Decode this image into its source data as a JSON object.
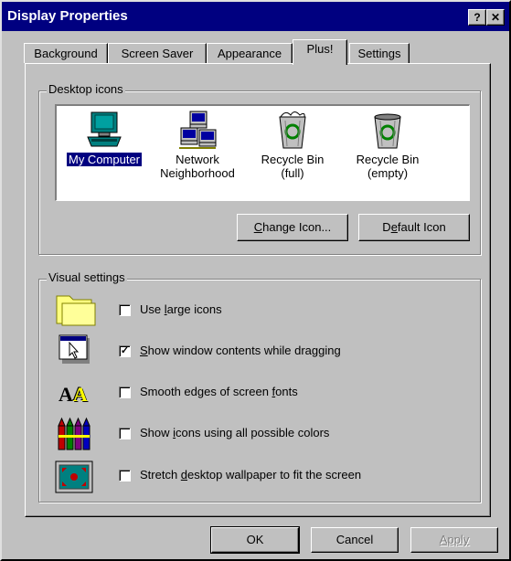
{
  "window": {
    "title": "Display Properties",
    "help_label": "?",
    "close_label": "✕"
  },
  "tabs": [
    {
      "label": "Background"
    },
    {
      "label": "Screen Saver"
    },
    {
      "label": "Appearance"
    },
    {
      "label": "Plus!",
      "active": true
    },
    {
      "label": "Settings"
    }
  ],
  "desktop_icons": {
    "legend": "Desktop icons",
    "items": [
      {
        "line1": "My Computer",
        "line2": "",
        "icon": "my-computer-icon",
        "selected": true
      },
      {
        "line1": "Network",
        "line2": "Neighborhood",
        "icon": "network-neighborhood-icon"
      },
      {
        "line1": "Recycle Bin",
        "line2": "(full)",
        "icon": "recycle-bin-full-icon"
      },
      {
        "line1": "Recycle Bin",
        "line2": "(empty)",
        "icon": "recycle-bin-empty-icon"
      }
    ],
    "change_icon": {
      "pre": "",
      "hot": "C",
      "post": "hange Icon..."
    },
    "default_icon": {
      "pre": "D",
      "hot": "e",
      "post": "fault Icon"
    }
  },
  "visual_settings": {
    "legend": "Visual settings",
    "options": [
      {
        "pre": "Use ",
        "hot": "l",
        "post": "arge icons",
        "checked": false,
        "icon": "folder-icon"
      },
      {
        "pre": "",
        "hot": "S",
        "post": "how window contents while dragging",
        "checked": true,
        "icon": "window-drag-icon"
      },
      {
        "pre": "Smooth edges of screen ",
        "hot": "f",
        "post": "onts",
        "checked": false,
        "icon": "fonts-icon"
      },
      {
        "pre": "Show ",
        "hot": "i",
        "post": "cons using all possible colors",
        "checked": false,
        "icon": "crayons-icon"
      },
      {
        "pre": "Stretch ",
        "hot": "d",
        "post": "esktop wallpaper to fit the screen",
        "checked": false,
        "icon": "monitor-wallpaper-icon"
      }
    ]
  },
  "buttons": {
    "ok": "OK",
    "cancel": "Cancel",
    "apply": "Apply"
  },
  "colors": {
    "titlebar": "#000080",
    "face": "#c0c0c0",
    "selection": "#000080"
  }
}
